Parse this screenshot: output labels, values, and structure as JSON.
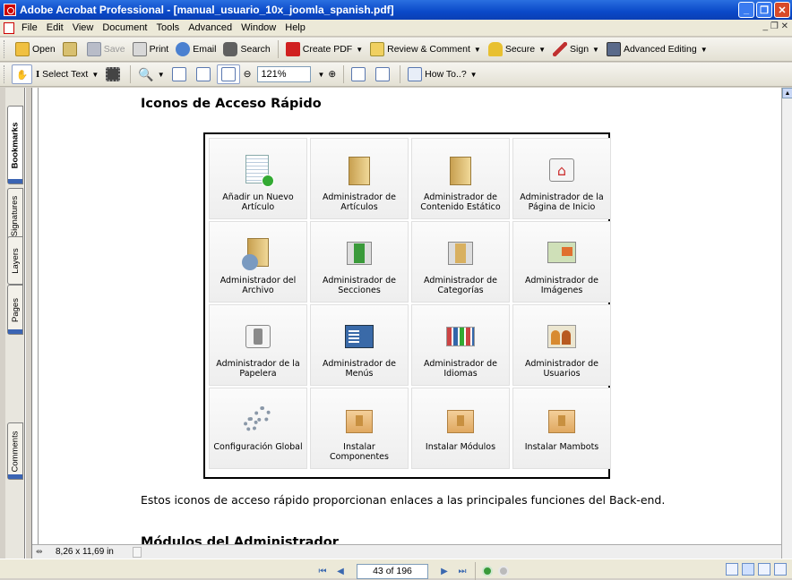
{
  "window": {
    "title": "Adobe Acrobat Professional - [manual_usuario_10x_joomla_spanish.pdf]"
  },
  "menu": {
    "items": [
      "File",
      "Edit",
      "View",
      "Document",
      "Tools",
      "Advanced",
      "Window",
      "Help"
    ]
  },
  "toolbar1": {
    "open": "Open",
    "save": "Save",
    "print": "Print",
    "email": "Email",
    "search": "Search",
    "create_pdf": "Create PDF",
    "review": "Review & Comment",
    "secure": "Secure",
    "sign": "Sign",
    "advanced_editing": "Advanced Editing"
  },
  "toolbar2": {
    "select_text": "Select Text",
    "zoom": "121%",
    "how_to": "How To..?"
  },
  "side_tabs": {
    "bookmarks": "Bookmarks",
    "signatures": "Signatures",
    "layers": "Layers",
    "pages": "Pages",
    "comments": "Comments"
  },
  "document": {
    "heading": "Iconos de Acceso Rápido",
    "icons": [
      {
        "label": "Añadir un Nuevo Artículo",
        "icon": "add-article-icon"
      },
      {
        "label": "Administrador de Artículos",
        "icon": "folder-icon"
      },
      {
        "label": "Administrador de Contenido Estático",
        "icon": "folder-icon"
      },
      {
        "label": "Administrador de la Página de Inicio",
        "icon": "home-icon"
      },
      {
        "label": "Administrador del Archivo",
        "icon": "archive-icon"
      },
      {
        "label": "Administrador de Secciones",
        "icon": "sections-icon"
      },
      {
        "label": "Administrador de Categorías",
        "icon": "categories-icon"
      },
      {
        "label": "Administrador de Imágenes",
        "icon": "images-icon"
      },
      {
        "label": "Administrador de la Papelera",
        "icon": "trash-icon"
      },
      {
        "label": "Administrador de Menús",
        "icon": "menu-icon"
      },
      {
        "label": "Administrador de Idiomas",
        "icon": "languages-icon"
      },
      {
        "label": "Administrador de Usuarios",
        "icon": "users-icon"
      },
      {
        "label": "Configuración Global",
        "icon": "gears-icon"
      },
      {
        "label": "Instalar Componentes",
        "icon": "box-icon"
      },
      {
        "label": "Instalar Módulos",
        "icon": "box-icon"
      },
      {
        "label": "Instalar Mambots",
        "icon": "box-icon"
      }
    ],
    "body_text": "Estos iconos de acceso rápido proporcionan enlaces a las principales funciones del Back-end.",
    "next_heading": "Módulos del Administrador"
  },
  "status": {
    "page_size": "8,26 x 11,69 in",
    "page_indicator": "43 of 196"
  }
}
